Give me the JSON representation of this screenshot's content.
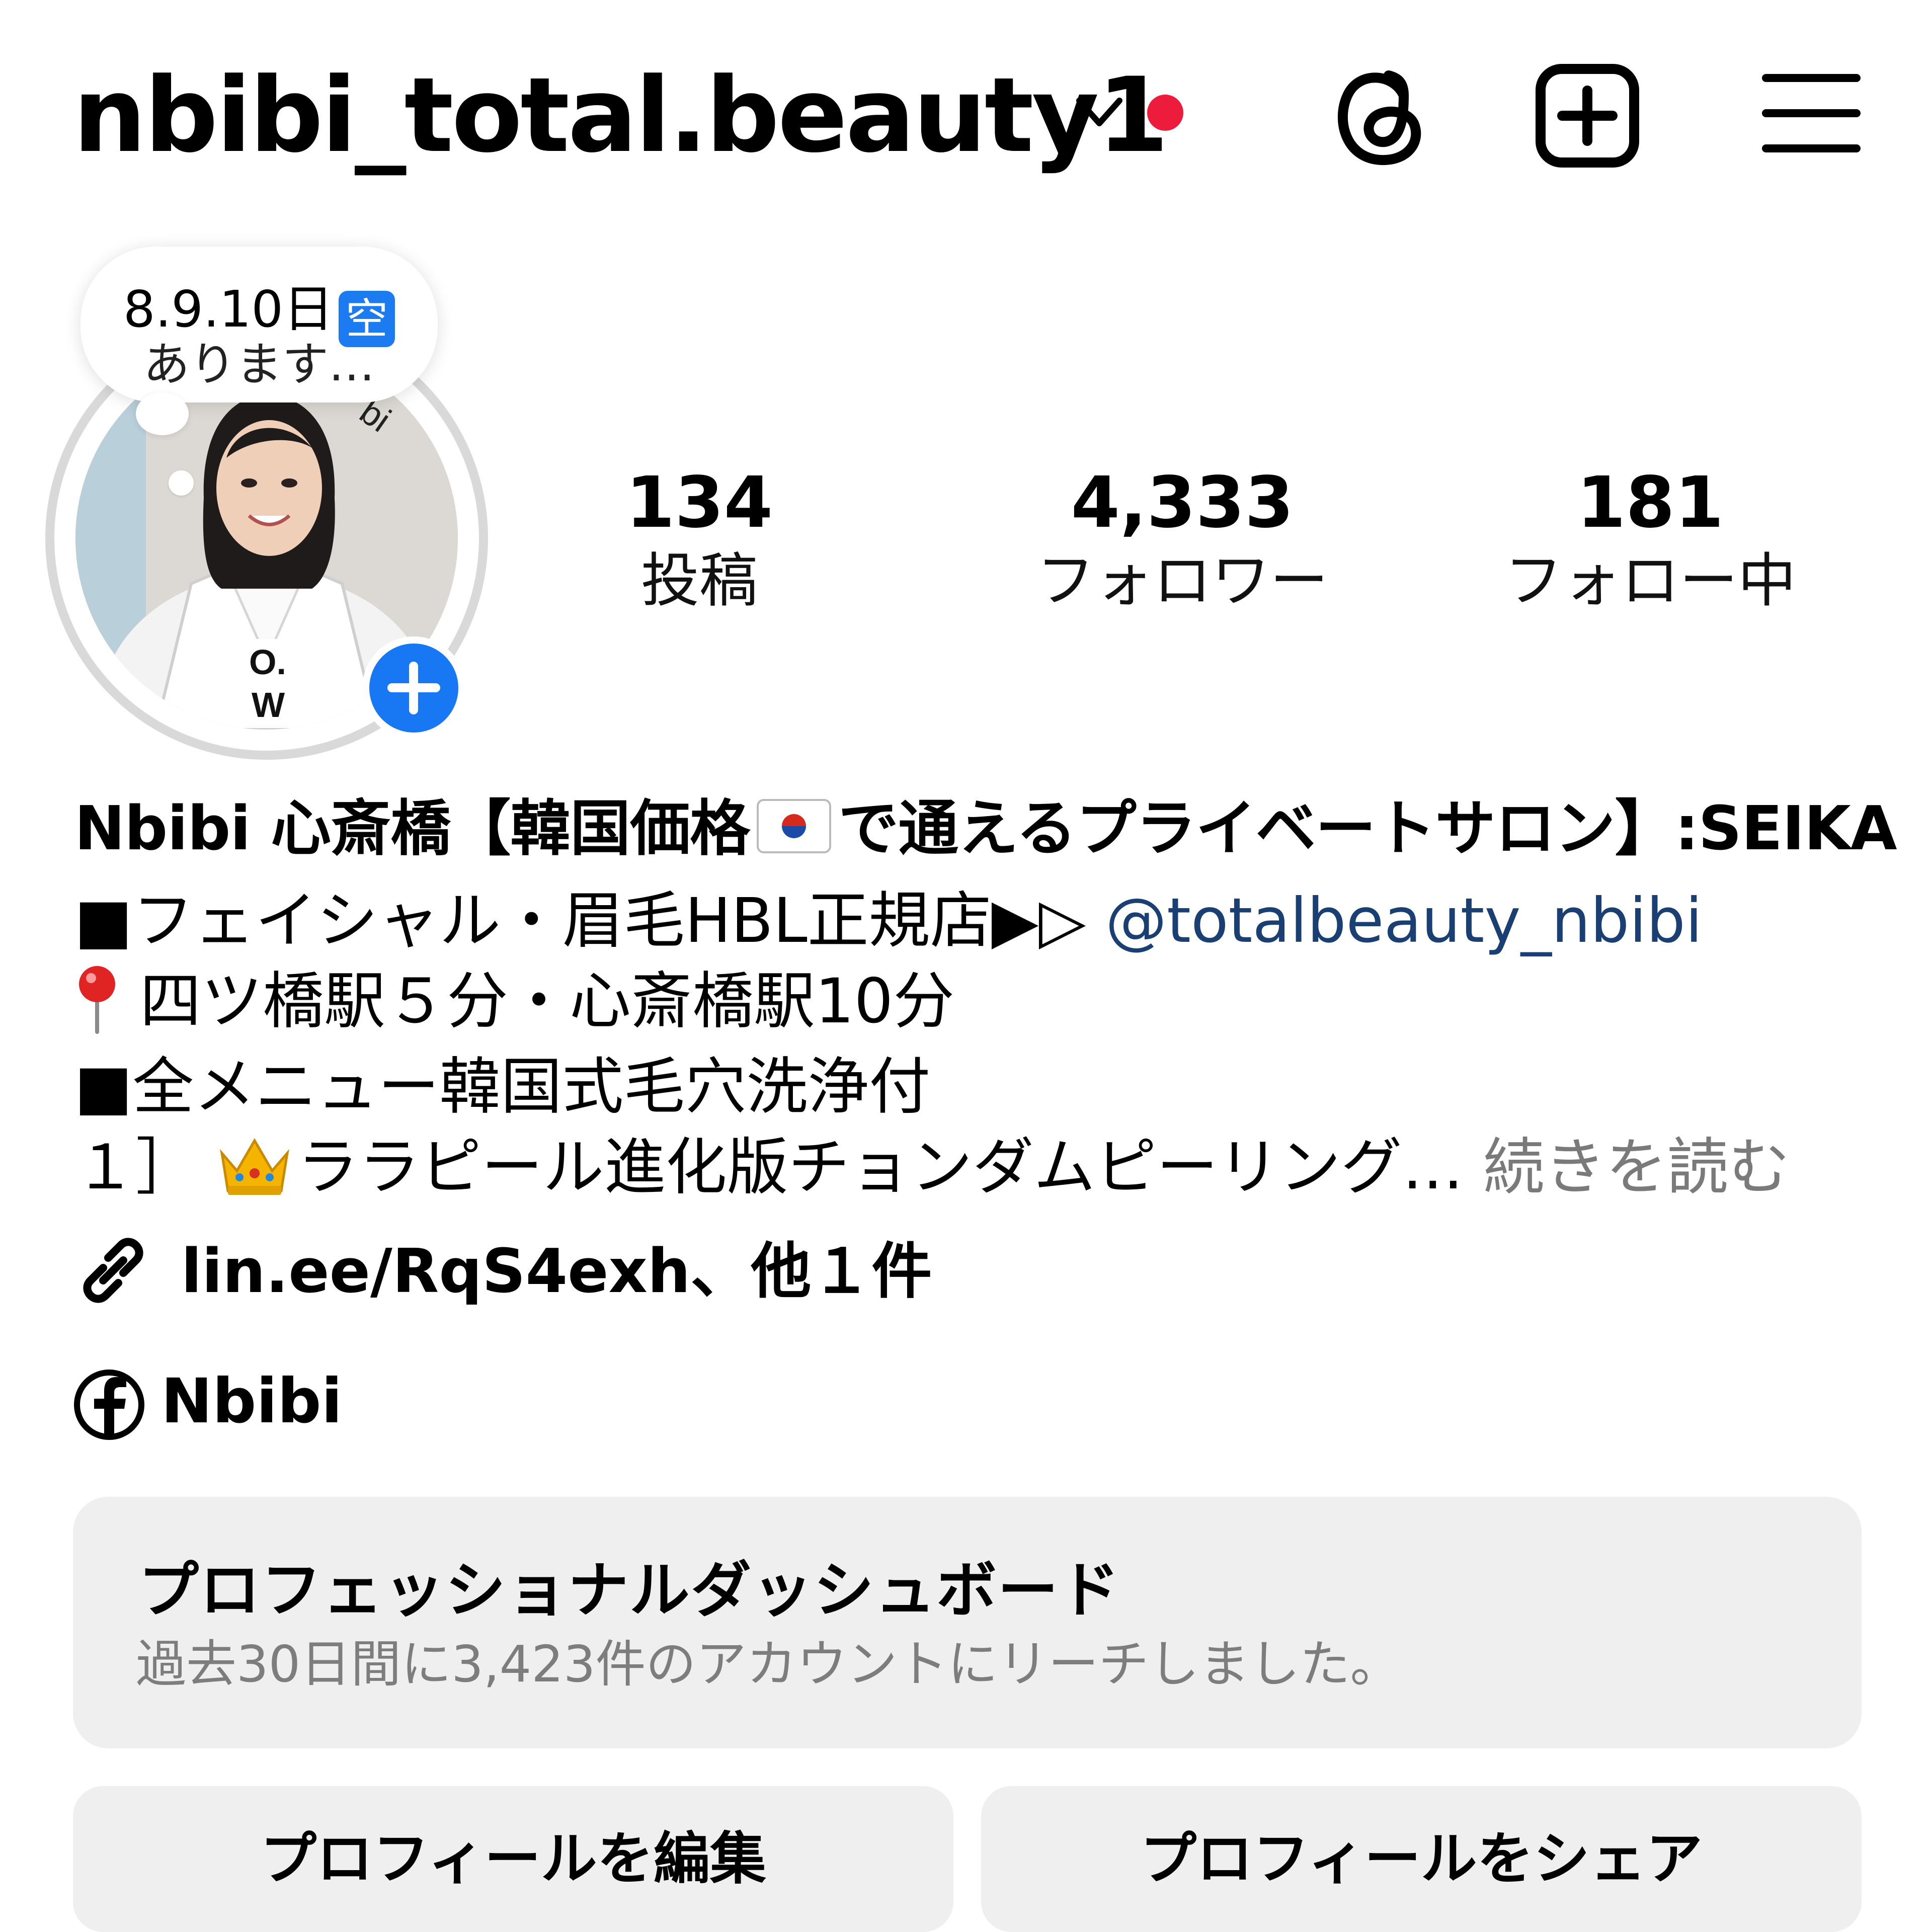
{
  "header": {
    "username": "nbibi_total.beauty1",
    "icons": [
      "chevron-down-icon",
      "notification-dot",
      "threads-icon",
      "add-post-icon",
      "menu-icon"
    ],
    "notification_color": "#ed1c3d"
  },
  "note": {
    "line1": "8.9.10日",
    "badge": "空",
    "line2": "あります…"
  },
  "stats": {
    "posts": {
      "value": "134",
      "label": "投稿"
    },
    "followers": {
      "value": "4,333",
      "label": "フォロワー"
    },
    "following": {
      "value": "181",
      "label": "フォロー中"
    }
  },
  "bio": {
    "name_part1": "Nbibi 心斎橋【韓国価格",
    "name_part2": "で通えるプライベートサロン】:SEIKA",
    "line1_text": "■フェイシャル・眉毛HBL正規店▶▷",
    "line1_mention": "@totalbeauty_nbibi",
    "line2": "四ツ橋駅５分・心斎橋駅10分",
    "line3": "■全メニュー韓国式毛穴洗浄付",
    "line4_prefix": "１］",
    "line4_text": "ララピール進化版チョンダムピーリング…",
    "more": "続きを読む",
    "link": "lin.ee/RqS4exh、他１件",
    "facebook": "Nbibi"
  },
  "dashboard": {
    "title": "プロフェッショナルダッシュボード",
    "subtitle": "過去30日間に3,423件のアカウントにリーチしました。"
  },
  "buttons": {
    "edit": "プロフィールを編集",
    "share": "プロフィールをシェア"
  },
  "colors": {
    "accent_blue": "#1877f2",
    "mention": "#1a3f72",
    "button_bg": "#efefef"
  }
}
